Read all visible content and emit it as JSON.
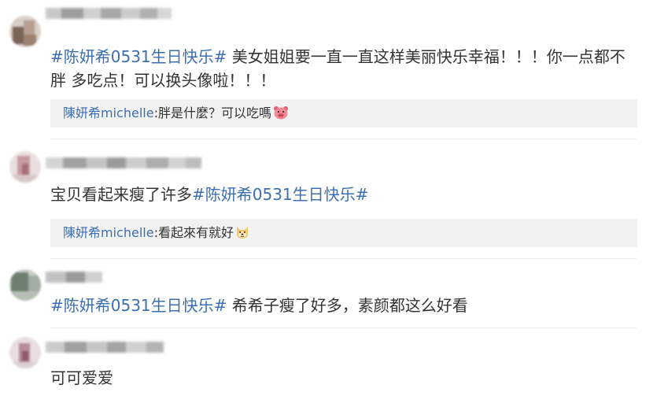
{
  "comments": [
    {
      "hashtag": "#陈妍希0531生日快乐#",
      "text": " 美女姐姐要一直一直这样美丽快乐幸福！！！你一点都不胖 多吃点！可以换头像啦！！！",
      "reply": {
        "name": "陳妍希michelle",
        "text": ":胖是什麼？可以吃嗎",
        "emoji": "pig-face-icon"
      }
    },
    {
      "text": "宝贝看起来瘦了许多",
      "hashtag": "#陈妍希0531生日快乐#",
      "reply": {
        "name": "陳妍希michelle",
        "text": ":看起來有就好",
        "emoji": "doge-face-icon"
      }
    },
    {
      "hashtag": "#陈妍希0531生日快乐#",
      "text": " 希希子瘦了好多，素颜都这么好看"
    },
    {
      "text": "可可爱爱"
    }
  ],
  "colors": {
    "link": "#3b6fb0",
    "text": "#333333",
    "reply_bg": "#f2f2f2"
  }
}
